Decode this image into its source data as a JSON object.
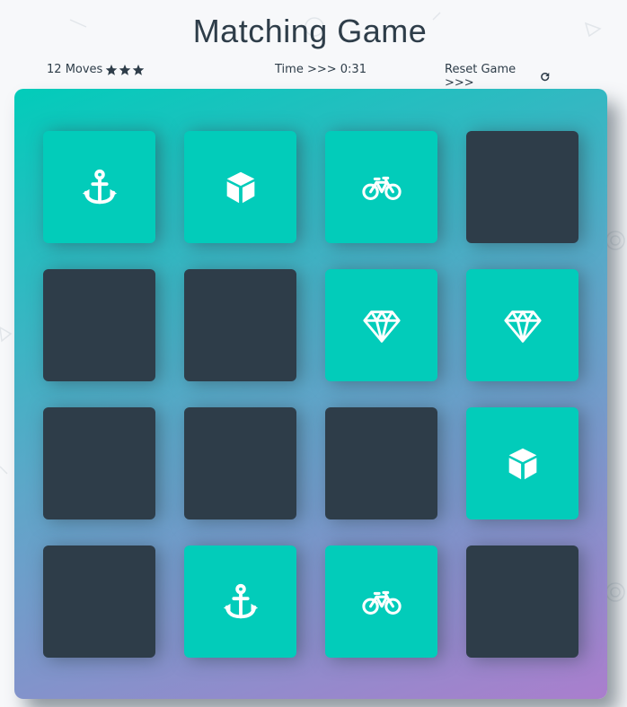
{
  "header": {
    "title": "Matching Game"
  },
  "score_panel": {
    "moves_count": "12",
    "moves_label": "Moves",
    "stars": [
      "star-icon",
      "star-icon",
      "star-icon"
    ],
    "timer_label": "Time >>> ",
    "timer_value": "0:31",
    "reset_label": "Reset Game >>>",
    "reset_icon": "repeat-icon"
  },
  "colors": {
    "card_hidden": "#2e3d49",
    "card_matched": "#02ccba",
    "deck_gradient_start": "#02ccba",
    "deck_gradient_end": "#aa7ecd",
    "text": "#2e3d49"
  },
  "deck": {
    "rows": 4,
    "columns": 4,
    "cards": [
      {
        "state": "matched",
        "icon": "anchor-icon"
      },
      {
        "state": "matched",
        "icon": "cube-icon"
      },
      {
        "state": "matched",
        "icon": "bicycle-icon"
      },
      {
        "state": "hidden",
        "icon": ""
      },
      {
        "state": "hidden",
        "icon": ""
      },
      {
        "state": "hidden",
        "icon": ""
      },
      {
        "state": "matched",
        "icon": "diamond-icon"
      },
      {
        "state": "matched",
        "icon": "diamond-icon"
      },
      {
        "state": "hidden",
        "icon": ""
      },
      {
        "state": "hidden",
        "icon": ""
      },
      {
        "state": "hidden",
        "icon": ""
      },
      {
        "state": "matched",
        "icon": "cube-icon"
      },
      {
        "state": "hidden",
        "icon": ""
      },
      {
        "state": "matched",
        "icon": "anchor-icon"
      },
      {
        "state": "matched",
        "icon": "bicycle-icon"
      },
      {
        "state": "hidden",
        "icon": ""
      }
    ]
  }
}
